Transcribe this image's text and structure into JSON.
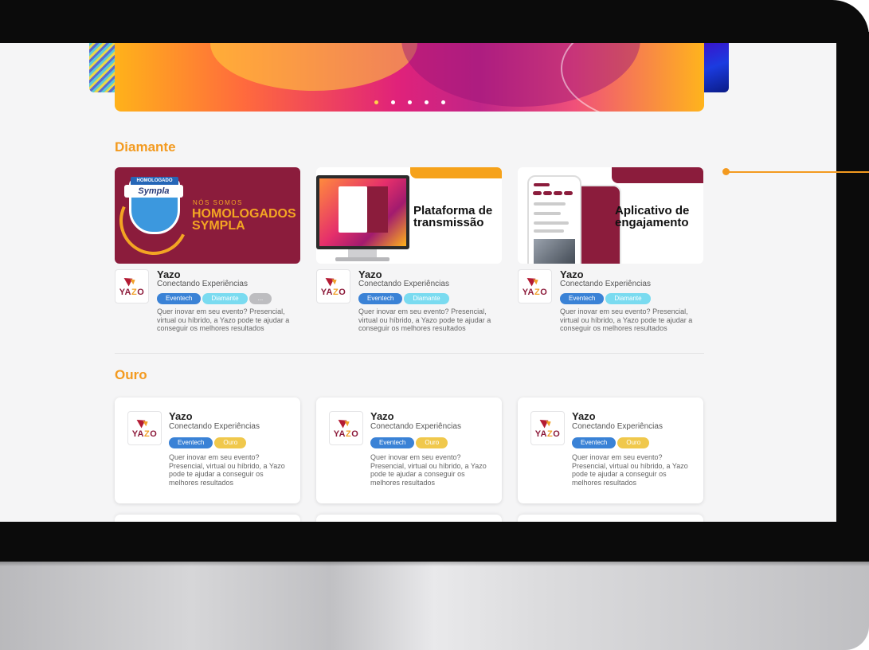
{
  "carousel": {
    "dots": 5,
    "active_index": 0
  },
  "sections": {
    "diamante": {
      "title": "Diamante",
      "cards": [
        {
          "image": {
            "kind": "sympla-badge",
            "badge_top": "HOMOLOGADO",
            "badge_brand": "Sympla",
            "line1": "NÓS SOMOS",
            "line2": "HOMOLOGADOS",
            "line3": "SYMPLA"
          },
          "company": "Yazo",
          "tagline": "Conectando Experiências",
          "tags": [
            "Eventech",
            "Diamante",
            "..."
          ],
          "description": "Quer inovar em seu evento? Presencial, virtual ou híbrido, a Yazo pode te ajudar a conseguir os melhores resultados"
        },
        {
          "image": {
            "kind": "monitor",
            "title_line1": "Plataforma de",
            "title_line2": "transmissão"
          },
          "company": "Yazo",
          "tagline": "Conectando Experiências",
          "tags": [
            "Eventech",
            "Diamante"
          ],
          "description": "Quer inovar em seu evento? Presencial, virtual ou híbrido, a Yazo pode te ajudar a conseguir os melhores resultados"
        },
        {
          "image": {
            "kind": "phones",
            "title_line1": "Aplicativo de",
            "title_line2": "engajamento"
          },
          "company": "Yazo",
          "tagline": "Conectando Experiências",
          "tags": [
            "Eventech",
            "Diamante"
          ],
          "description": "Quer inovar em seu evento? Presencial, virtual ou híbrido, a Yazo pode te ajudar a conseguir os melhores resultados"
        }
      ]
    },
    "ouro": {
      "title": "Ouro",
      "cards": [
        {
          "company": "Yazo",
          "tagline": "Conectando Experiências",
          "tags": [
            "Eventech",
            "Ouro"
          ],
          "description": "Quer inovar em seu evento? Presencial, virtual ou híbrido, a Yazo pode te ajudar a conseguir os melhores resultados"
        },
        {
          "company": "Yazo",
          "tagline": "Conectando Experiências",
          "tags": [
            "Eventech",
            "Ouro"
          ],
          "description": "Quer inovar em seu evento? Presencial, virtual ou híbrido, a Yazo pode te ajudar a conseguir os melhores resultados"
        },
        {
          "company": "Yazo",
          "tagline": "Conectando Experiências",
          "tags": [
            "Eventech",
            "Ouro"
          ],
          "description": "Quer inovar em seu evento? Presencial, virtual ou híbrido, a Yazo pode te ajudar a conseguir os melhores resultados"
        }
      ]
    }
  },
  "logo": {
    "text_pre": "YA",
    "text_z": "Z",
    "text_post": "O"
  },
  "colors": {
    "accent": "#f39a1f",
    "brand_maroon": "#8b1c3c",
    "tag_eventech": "#3a82d6",
    "tag_diamante": "#7adbf0",
    "tag_ouro": "#f0c84c",
    "tag_more": "#bdbdc0"
  }
}
